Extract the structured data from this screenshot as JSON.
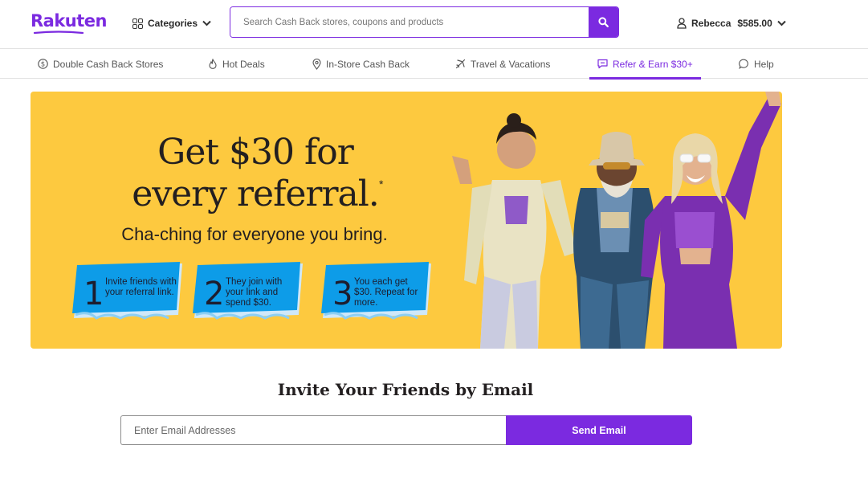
{
  "brand": {
    "name": "Rakuten",
    "color": "#7b2ae0"
  },
  "header": {
    "categories_label": "Categories",
    "search": {
      "placeholder": "Search Cash Back stores, coupons and products",
      "value": ""
    },
    "account": {
      "name": "Rebecca",
      "balance": "$585.00"
    }
  },
  "subnav": {
    "items": [
      {
        "label": "Double Cash Back Stores",
        "icon": "dollar-circle-icon"
      },
      {
        "label": "Hot Deals",
        "icon": "flame-icon"
      },
      {
        "label": "In-Store Cash Back",
        "icon": "location-pin-icon"
      },
      {
        "label": "Travel & Vacations",
        "icon": "plane-icon"
      },
      {
        "label": "Refer & Earn $30+",
        "icon": "chat-star-icon",
        "active": true
      },
      {
        "label": "Help",
        "icon": "speech-bubble-icon"
      }
    ]
  },
  "hero": {
    "title_line1": "Get $30 for",
    "title_line2": "every referral.",
    "asterisk": "*",
    "subtitle": "Cha-ching for everyone you bring.",
    "background": "#fdc93f",
    "steps": [
      {
        "number": "1",
        "text": "Invite friends with your referral link."
      },
      {
        "number": "2",
        "text": "They join with your link and spend $30."
      },
      {
        "number": "3",
        "text": "You each get $30. Repeat for more."
      }
    ]
  },
  "invite": {
    "title": "Invite Your Friends by Email",
    "email_placeholder": "Enter Email Addresses",
    "email_value": "",
    "send_label": "Send Email"
  }
}
